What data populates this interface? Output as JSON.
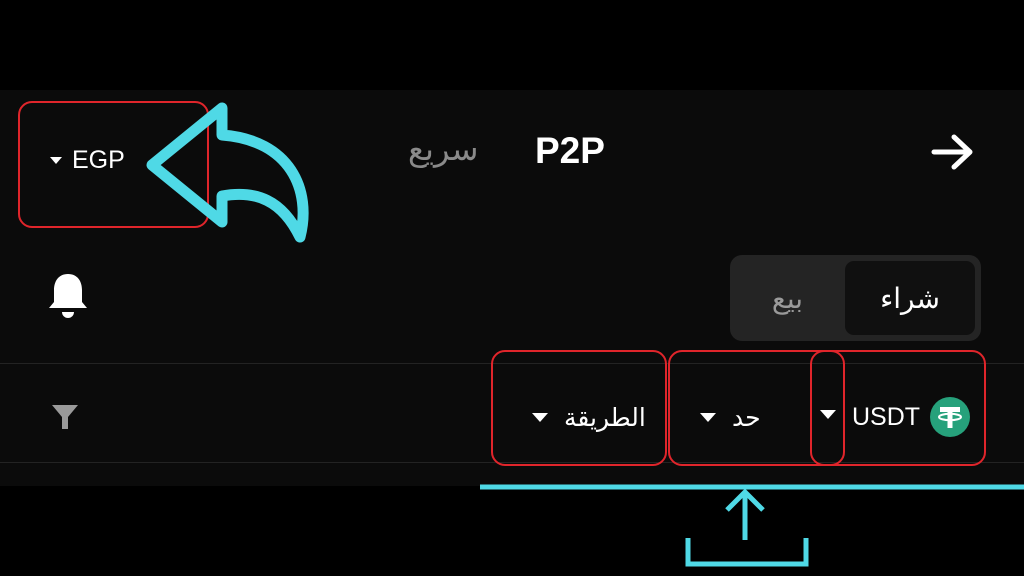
{
  "header": {
    "currency_code": "EGP",
    "tab_quick": "سريع",
    "tab_p2p": "P2P",
    "back_icon": "arrow-right-icon"
  },
  "notifications": {
    "icon": "bell-icon"
  },
  "trade_toggle": {
    "sell_label": "بيع",
    "buy_label": "شراء",
    "selected": "buy"
  },
  "filters": {
    "filter_icon": "funnel-icon",
    "method_label": "الطريقة",
    "limit_label": "حد",
    "asset_label": "USDT",
    "asset_icon": "tether-icon"
  },
  "colors": {
    "background": "#000000",
    "panel": "#0b0b0b",
    "annotation_red": "#e0252b",
    "annotation_cyan": "#4fd9e6",
    "tether_green": "#26a17b",
    "muted_text": "#8a8a8a"
  }
}
